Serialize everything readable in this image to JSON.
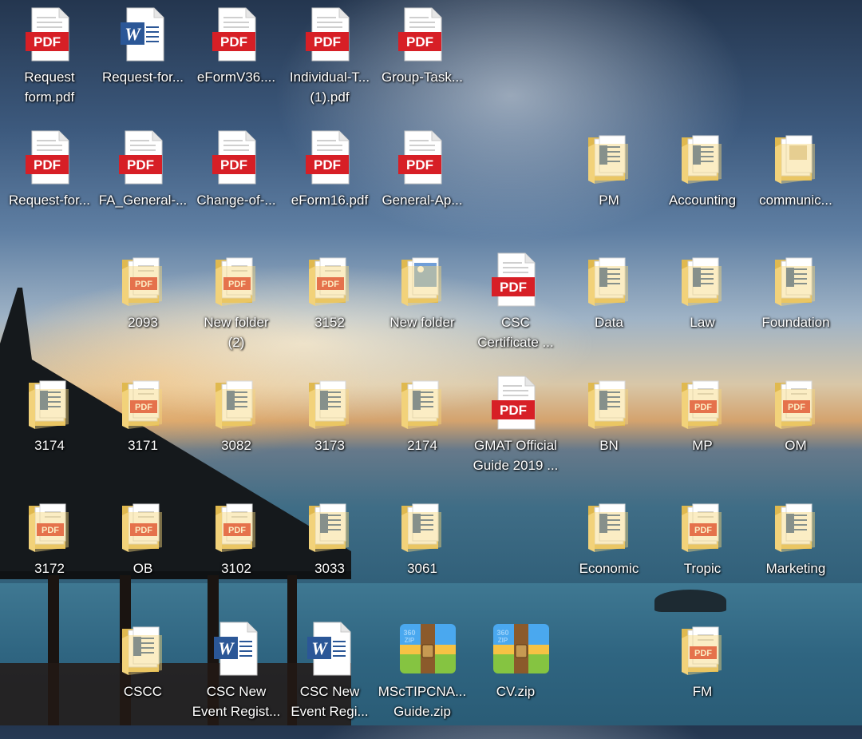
{
  "desktop": {
    "icons": [
      {
        "label": "Request\nform.pdf",
        "type": "pdf-file-icon"
      },
      {
        "label": "Request-for...",
        "type": "word-file-icon"
      },
      {
        "label": "eFormV36....",
        "type": "pdf-file-icon"
      },
      {
        "label": "Individual-T...\n(1).pdf",
        "type": "pdf-file-icon"
      },
      {
        "label": "Group-Task...",
        "type": "pdf-file-icon"
      },
      {
        "label": "Request-for...",
        "type": "pdf-file-icon"
      },
      {
        "label": "FA_General-...",
        "type": "pdf-file-icon"
      },
      {
        "label": "Change-of-...",
        "type": "pdf-file-icon"
      },
      {
        "label": "eForm16.pdf",
        "type": "pdf-file-icon"
      },
      {
        "label": "General-Ap...",
        "type": "pdf-file-icon"
      },
      {
        "label": "PM",
        "type": "folder-word-icon"
      },
      {
        "label": "Accounting",
        "type": "folder-word-icon"
      },
      {
        "label": "communic...",
        "type": "folder-icon"
      },
      {
        "label": "2093",
        "type": "folder-pdf-icon"
      },
      {
        "label": "New folder\n(2)",
        "type": "folder-pdf-icon"
      },
      {
        "label": "3152",
        "type": "folder-pdf-icon"
      },
      {
        "label": "New folder",
        "type": "folder-image-icon"
      },
      {
        "label": "CSC\nCertificate ...",
        "type": "pdf-file-icon"
      },
      {
        "label": "Data",
        "type": "folder-word-icon"
      },
      {
        "label": "Law",
        "type": "folder-word-icon"
      },
      {
        "label": "Foundation",
        "type": "folder-word-icon"
      },
      {
        "label": "3174",
        "type": "folder-word-icon"
      },
      {
        "label": "3171",
        "type": "folder-pdf-icon"
      },
      {
        "label": "3082",
        "type": "folder-word-icon"
      },
      {
        "label": "3173",
        "type": "folder-word-icon"
      },
      {
        "label": "2174",
        "type": "folder-word-icon"
      },
      {
        "label": "GMAT Official\nGuide 2019 ...",
        "type": "pdf-file-icon"
      },
      {
        "label": "BN",
        "type": "folder-word-icon"
      },
      {
        "label": "MP",
        "type": "folder-pdf-icon"
      },
      {
        "label": "OM",
        "type": "folder-pdf-icon"
      },
      {
        "label": "3172",
        "type": "folder-pdf-icon"
      },
      {
        "label": "OB",
        "type": "folder-pdf-icon"
      },
      {
        "label": "3102",
        "type": "folder-pdf-icon"
      },
      {
        "label": "3033",
        "type": "folder-word-icon"
      },
      {
        "label": "3061",
        "type": "folder-word-icon"
      },
      {
        "label": "Economic",
        "type": "folder-word-icon"
      },
      {
        "label": "Tropic",
        "type": "folder-pdf-icon"
      },
      {
        "label": "Marketing",
        "type": "folder-word-icon"
      },
      {
        "label": "CSCC",
        "type": "folder-word-icon"
      },
      {
        "label": "CSC New\nEvent Regist...",
        "type": "word-file-icon"
      },
      {
        "label": "CSC New\nEvent Regi...",
        "type": "word-file-icon"
      },
      {
        "label": "MScTIPCNA...\nGuide.zip",
        "type": "zip-archive-icon"
      },
      {
        "label": "CV.zip",
        "type": "zip-archive-icon"
      },
      {
        "label": "FM",
        "type": "folder-pdf-icon"
      }
    ],
    "pdf_badge": "PDF",
    "word_badge": "W",
    "zip_badge": "360\nZIP"
  }
}
